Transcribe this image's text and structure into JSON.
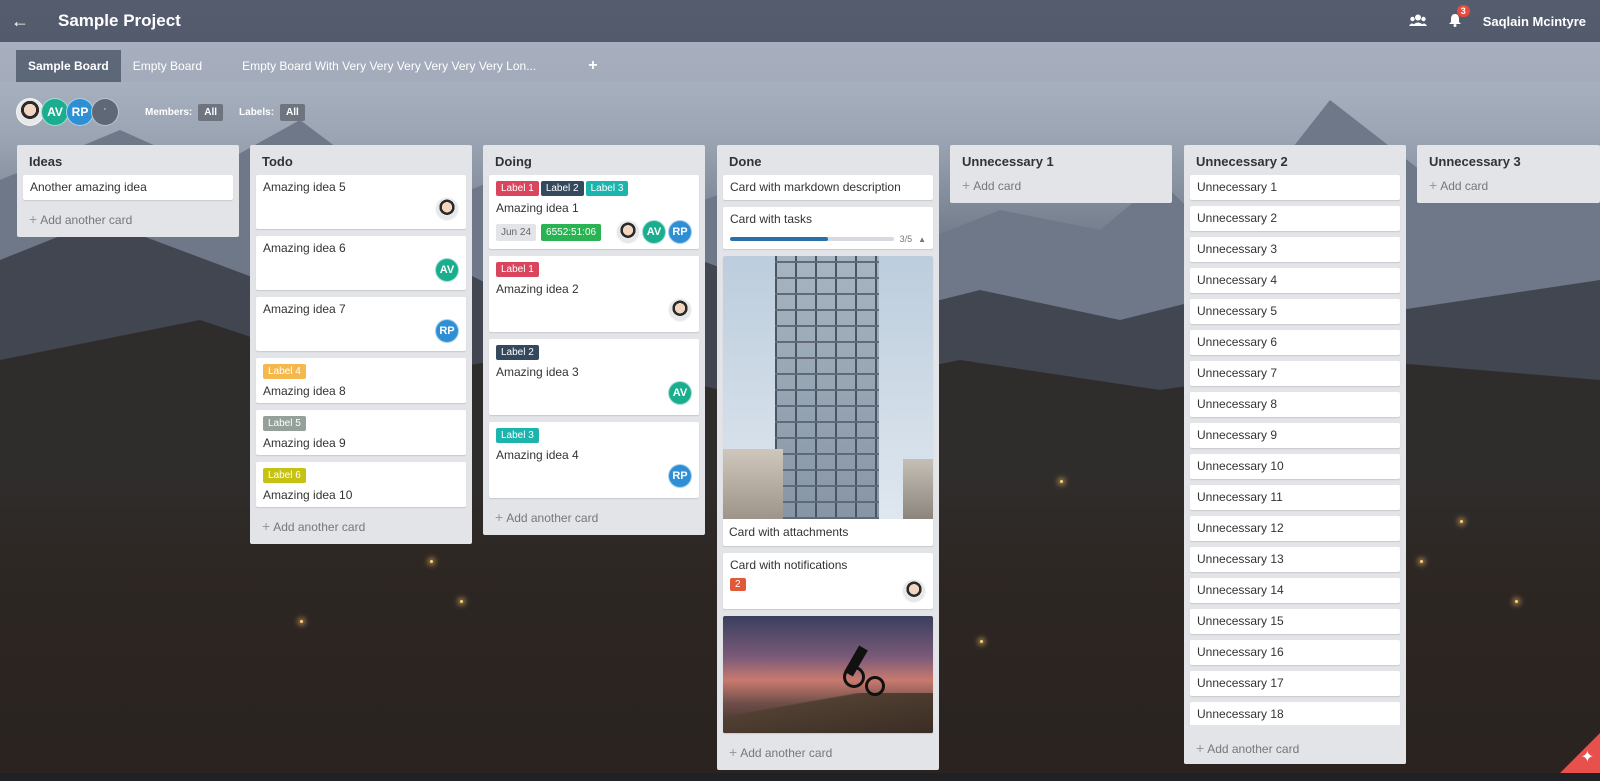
{
  "header": {
    "back_icon": "arrow-left-icon",
    "project_title": "Sample Project",
    "team_icon": "people-icon",
    "notification_count": "3",
    "user_name": "Saqlain Mcintyre"
  },
  "tabs": [
    {
      "label": "Sample Board",
      "active": true
    },
    {
      "label": "Empty Board",
      "active": false
    },
    {
      "label": "Empty Board With Very Very Very Very Very Very Lon...",
      "active": false
    }
  ],
  "add_tab_label": "+",
  "members": {
    "avatars": [
      "",
      "AV",
      "RP"
    ],
    "add_member_icon": "user-plus-icon",
    "members_label": "Members:",
    "members_value": "All",
    "labels_label": "Labels:",
    "labels_value": "All"
  },
  "columns": {
    "ideas": {
      "title": "Ideas",
      "cards": [
        "Another amazing idea"
      ],
      "add_label": "Add another card"
    },
    "todo": {
      "title": "Todo",
      "cards": [
        {
          "title": "Amazing idea 5",
          "avatar": ""
        },
        {
          "title": "Amazing idea 6",
          "avatar": "AV"
        },
        {
          "title": "Amazing idea 7",
          "avatar": "RP"
        },
        {
          "title": "Amazing idea 8",
          "label": "Label 4"
        },
        {
          "title": "Amazing idea 9",
          "label": "Label 5"
        },
        {
          "title": "Amazing idea 10",
          "label": "Label 6"
        }
      ],
      "add_label": "Add another card"
    },
    "doing": {
      "title": "Doing",
      "cards": [
        {
          "title": "Amazing idea 1",
          "labels": [
            "Label 1",
            "Label 2",
            "Label 3"
          ],
          "date": "Jun 24",
          "timer": "6552:51:06",
          "avatars": [
            "",
            "AV",
            "RP"
          ]
        },
        {
          "title": "Amazing idea 2",
          "labels": [
            "Label 1"
          ]
        },
        {
          "title": "Amazing idea 3",
          "labels": [
            "Label 2"
          ],
          "avatar": "AV"
        },
        {
          "title": "Amazing idea 4",
          "labels": [
            "Label 3"
          ],
          "avatar": "RP"
        }
      ],
      "add_label": "Add another card"
    },
    "done": {
      "title": "Done",
      "cards": {
        "markdown": "Card with markdown description",
        "tasks": "Card with tasks",
        "tasks_progress": "3/5",
        "tasks_fraction": 0.6,
        "attachments": "Card with attachments",
        "notifications": "Card with notifications",
        "notification_count": "2"
      },
      "add_label": "Add another card"
    },
    "unnecessary1": {
      "title": "Unnecessary 1",
      "add_label": "Add card"
    },
    "unnecessary2": {
      "title": "Unnecessary 2",
      "cards": [
        "Unnecessary 1",
        "Unnecessary 2",
        "Unnecessary 3",
        "Unnecessary 4",
        "Unnecessary 5",
        "Unnecessary 6",
        "Unnecessary 7",
        "Unnecessary 8",
        "Unnecessary 9",
        "Unnecessary 10",
        "Unnecessary 11",
        "Unnecessary 12",
        "Unnecessary 13",
        "Unnecessary 14",
        "Unnecessary 15",
        "Unnecessary 16",
        "Unnecessary 17",
        "Unnecessary 18"
      ],
      "add_label": "Add another card"
    },
    "unnecessary3": {
      "title": "Unnecessary 3",
      "add_label": "Add card"
    }
  },
  "colors": {
    "label_red": "#d9455d",
    "label_navy": "#34495e",
    "label_teal": "#1bb5ad",
    "label_orange": "#f5b84d",
    "label_grey": "#95a09a",
    "label_lime": "#c6c214",
    "avatar_av": "#1aae8e",
    "avatar_rp": "#2e8fd4",
    "timer_green": "#2ab352",
    "progress_blue": "#2a6fa8"
  }
}
